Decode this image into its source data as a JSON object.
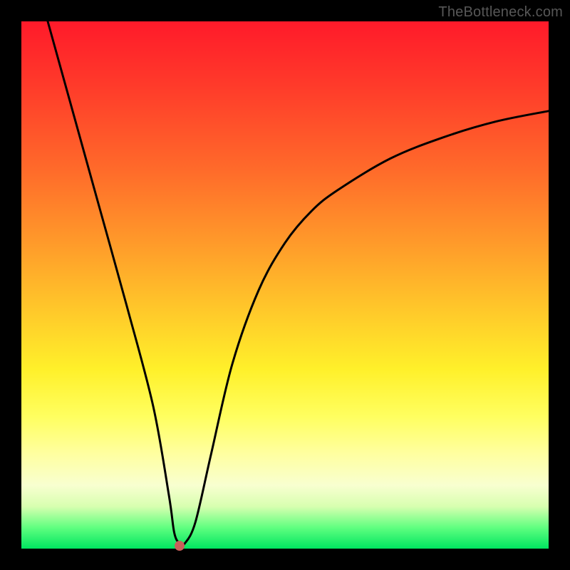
{
  "attribution": "TheBottleneck.com",
  "chart_data": {
    "type": "line",
    "title": "",
    "xlabel": "",
    "ylabel": "",
    "xlim": [
      0,
      100
    ],
    "ylim": [
      0,
      100
    ],
    "grid": false,
    "legend": false,
    "background": "vertical-gradient red→orange→yellow→green",
    "series": [
      {
        "name": "bottleneck-curve",
        "color": "#000000",
        "x": [
          5,
          10,
          15,
          20,
          25,
          28,
          29,
          30,
          31,
          33,
          36,
          40,
          45,
          50,
          55,
          60,
          70,
          80,
          90,
          100
        ],
        "y": [
          100,
          82,
          64,
          46,
          27,
          10,
          3,
          1,
          1,
          5,
          18,
          35,
          49,
          58,
          64,
          68,
          74,
          78,
          81,
          83
        ]
      }
    ],
    "annotations": [
      {
        "name": "min-marker",
        "x": 30,
        "y": 0.5,
        "color": "#c9605a",
        "shape": "circle"
      }
    ]
  },
  "colors": {
    "frame": "#000000",
    "attribution_text": "#575757",
    "curve": "#000000",
    "marker": "#c9605a"
  }
}
